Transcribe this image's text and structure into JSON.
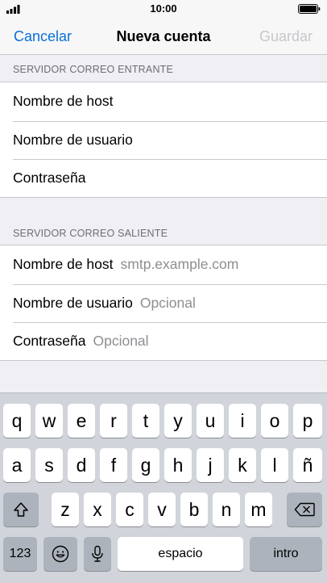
{
  "status_bar": {
    "time": "10:00"
  },
  "nav": {
    "cancel": "Cancelar",
    "title": "Nueva cuenta",
    "save": "Guardar"
  },
  "incoming": {
    "header": "SERVIDOR CORREO ENTRANTE",
    "rows": [
      {
        "label": "Nombre de host",
        "value": ""
      },
      {
        "label": "Nombre de usuario",
        "value": ""
      },
      {
        "label": "Contraseña",
        "value": ""
      }
    ]
  },
  "outgoing": {
    "header": "SERVIDOR CORREO SALIENTE",
    "rows": [
      {
        "label": "Nombre de host",
        "value": "smtp.example.com"
      },
      {
        "label": "Nombre de usuario",
        "value": "Opcional"
      },
      {
        "label": "Contraseña",
        "value": "Opcional"
      }
    ]
  },
  "keyboard": {
    "row1": [
      "q",
      "w",
      "e",
      "r",
      "t",
      "y",
      "u",
      "i",
      "o",
      "p"
    ],
    "row2": [
      "a",
      "s",
      "d",
      "f",
      "g",
      "h",
      "j",
      "k",
      "l",
      "ñ"
    ],
    "row3": [
      "z",
      "x",
      "c",
      "v",
      "b",
      "n",
      "m"
    ],
    "numbers": "123",
    "space": "espacio",
    "return": "intro",
    "icons": {
      "shift": "shift-icon",
      "delete": "backspace-icon",
      "emoji": "emoji-icon",
      "mic": "microphone-icon"
    }
  }
}
